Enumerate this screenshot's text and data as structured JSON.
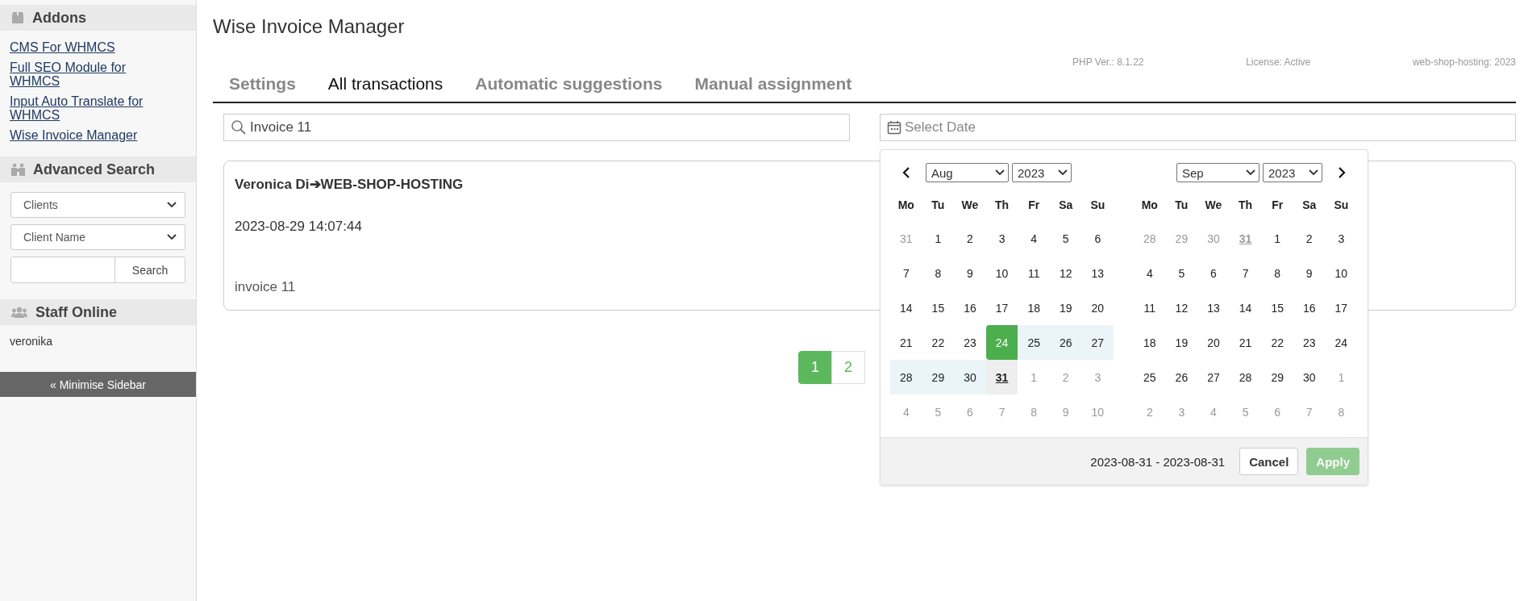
{
  "sidebar": {
    "addons": {
      "title": "Addons",
      "links": [
        "CMS For WHMCS",
        "Full SEO Module for WHMCS",
        "Input Auto Translate for WHMCS",
        "Wise Invoice Manager"
      ]
    },
    "advanced_search": {
      "title": "Advanced Search",
      "selects": [
        "Clients",
        "Client Name"
      ],
      "search_button": "Search"
    },
    "staff_online": {
      "title": "Staff Online",
      "users": [
        "veronika"
      ]
    },
    "minimise_button": "« Minimise Sidebar"
  },
  "main": {
    "title": "Wise Invoice Manager",
    "tabs": [
      {
        "label": "Settings",
        "selected": false
      },
      {
        "label": "All transactions",
        "selected": true
      },
      {
        "label": "Automatic suggestions",
        "selected": false
      },
      {
        "label": "Manual assignment",
        "selected": false
      }
    ],
    "info": [
      "PHP Ver.: 8.1.22",
      "License: Active",
      "web-shop-hosting: 2023"
    ],
    "search": {
      "value": "Invoice 11"
    },
    "date_field": {
      "placeholder": "Select Date"
    },
    "cards": [
      {
        "title": "Veronica Di➔WEB-SHOP-HOSTING",
        "date": "2023-08-29 14:07:44",
        "note": "invoice 11"
      }
    ],
    "pagination": [
      {
        "label": "1",
        "selected": true
      },
      {
        "label": "2",
        "selected": false
      }
    ],
    "datepicker": {
      "months": [
        {
          "month": "Aug",
          "year": "2023",
          "weekdays": [
            "Mo",
            "Tu",
            "We",
            "Th",
            "Fr",
            "Sa",
            "Su"
          ],
          "weeks": [
            [
              {
                "d": "31",
                "kind": "off",
                "today": false
              },
              {
                "d": "1",
                "kind": "day",
                "today": false
              },
              {
                "d": "2",
                "kind": "day",
                "today": false
              },
              {
                "d": "3",
                "kind": "day",
                "today": false
              },
              {
                "d": "4",
                "kind": "day",
                "today": false
              },
              {
                "d": "5",
                "kind": "day",
                "today": false
              },
              {
                "d": "6",
                "kind": "day",
                "today": false
              }
            ],
            [
              {
                "d": "7",
                "kind": "day",
                "today": false
              },
              {
                "d": "8",
                "kind": "day",
                "today": false
              },
              {
                "d": "9",
                "kind": "day",
                "today": false
              },
              {
                "d": "10",
                "kind": "day",
                "today": false
              },
              {
                "d": "11",
                "kind": "day",
                "today": false
              },
              {
                "d": "12",
                "kind": "day",
                "today": false
              },
              {
                "d": "13",
                "kind": "day",
                "today": false
              }
            ],
            [
              {
                "d": "14",
                "kind": "day",
                "today": false
              },
              {
                "d": "15",
                "kind": "day",
                "today": false
              },
              {
                "d": "16",
                "kind": "day",
                "today": false
              },
              {
                "d": "17",
                "kind": "day",
                "today": false
              },
              {
                "d": "18",
                "kind": "day",
                "today": false
              },
              {
                "d": "19",
                "kind": "day",
                "today": false
              },
              {
                "d": "20",
                "kind": "day",
                "today": false
              }
            ],
            [
              {
                "d": "21",
                "kind": "day",
                "today": false
              },
              {
                "d": "22",
                "kind": "day",
                "today": false
              },
              {
                "d": "23",
                "kind": "day",
                "today": false
              },
              {
                "d": "24",
                "kind": "start",
                "today": false
              },
              {
                "d": "25",
                "kind": "range",
                "today": false
              },
              {
                "d": "26",
                "kind": "range",
                "today": false
              },
              {
                "d": "27",
                "kind": "range",
                "today": false
              }
            ],
            [
              {
                "d": "28",
                "kind": "range",
                "today": false
              },
              {
                "d": "29",
                "kind": "range",
                "today": false
              },
              {
                "d": "30",
                "kind": "range",
                "today": false
              },
              {
                "d": "31",
                "kind": "end",
                "today": true
              },
              {
                "d": "1",
                "kind": "off",
                "today": false
              },
              {
                "d": "2",
                "kind": "off",
                "today": false
              },
              {
                "d": "3",
                "kind": "off",
                "today": false
              }
            ],
            [
              {
                "d": "4",
                "kind": "off",
                "today": false
              },
              {
                "d": "5",
                "kind": "off",
                "today": false
              },
              {
                "d": "6",
                "kind": "off",
                "today": false
              },
              {
                "d": "7",
                "kind": "off",
                "today": false
              },
              {
                "d": "8",
                "kind": "off",
                "today": false
              },
              {
                "d": "9",
                "kind": "off",
                "today": false
              },
              {
                "d": "10",
                "kind": "off",
                "today": false
              }
            ]
          ]
        },
        {
          "month": "Sep",
          "year": "2023",
          "weekdays": [
            "Mo",
            "Tu",
            "We",
            "Th",
            "Fr",
            "Sa",
            "Su"
          ],
          "weeks": [
            [
              {
                "d": "28",
                "kind": "off",
                "today": false
              },
              {
                "d": "29",
                "kind": "off",
                "today": false
              },
              {
                "d": "30",
                "kind": "off",
                "today": false
              },
              {
                "d": "31",
                "kind": "off",
                "today": true
              },
              {
                "d": "1",
                "kind": "day",
                "today": false
              },
              {
                "d": "2",
                "kind": "day",
                "today": false
              },
              {
                "d": "3",
                "kind": "day",
                "today": false
              }
            ],
            [
              {
                "d": "4",
                "kind": "day",
                "today": false
              },
              {
                "d": "5",
                "kind": "day",
                "today": false
              },
              {
                "d": "6",
                "kind": "day",
                "today": false
              },
              {
                "d": "7",
                "kind": "day",
                "today": false
              },
              {
                "d": "8",
                "kind": "day",
                "today": false
              },
              {
                "d": "9",
                "kind": "day",
                "today": false
              },
              {
                "d": "10",
                "kind": "day",
                "today": false
              }
            ],
            [
              {
                "d": "11",
                "kind": "day",
                "today": false
              },
              {
                "d": "12",
                "kind": "day",
                "today": false
              },
              {
                "d": "13",
                "kind": "day",
                "today": false
              },
              {
                "d": "14",
                "kind": "day",
                "today": false
              },
              {
                "d": "15",
                "kind": "day",
                "today": false
              },
              {
                "d": "16",
                "kind": "day",
                "today": false
              },
              {
                "d": "17",
                "kind": "day",
                "today": false
              }
            ],
            [
              {
                "d": "18",
                "kind": "day",
                "today": false
              },
              {
                "d": "19",
                "kind": "day",
                "today": false
              },
              {
                "d": "20",
                "kind": "day",
                "today": false
              },
              {
                "d": "21",
                "kind": "day",
                "today": false
              },
              {
                "d": "22",
                "kind": "day",
                "today": false
              },
              {
                "d": "23",
                "kind": "day",
                "today": false
              },
              {
                "d": "24",
                "kind": "day",
                "today": false
              }
            ],
            [
              {
                "d": "25",
                "kind": "day",
                "today": false
              },
              {
                "d": "26",
                "kind": "day",
                "today": false
              },
              {
                "d": "27",
                "kind": "day",
                "today": false
              },
              {
                "d": "28",
                "kind": "day",
                "today": false
              },
              {
                "d": "29",
                "kind": "day",
                "today": false
              },
              {
                "d": "30",
                "kind": "day",
                "today": false
              },
              {
                "d": "1",
                "kind": "off",
                "today": false
              }
            ],
            [
              {
                "d": "2",
                "kind": "off",
                "today": false
              },
              {
                "d": "3",
                "kind": "off",
                "today": false
              },
              {
                "d": "4",
                "kind": "off",
                "today": false
              },
              {
                "d": "5",
                "kind": "off",
                "today": false
              },
              {
                "d": "6",
                "kind": "off",
                "today": false
              },
              {
                "d": "7",
                "kind": "off",
                "today": false
              },
              {
                "d": "8",
                "kind": "off",
                "today": false
              }
            ]
          ]
        }
      ],
      "range_text": "2023-08-31 - 2023-08-31",
      "cancel": "Cancel",
      "apply": {
        "label": "Apply",
        "disabled": true
      }
    }
  }
}
